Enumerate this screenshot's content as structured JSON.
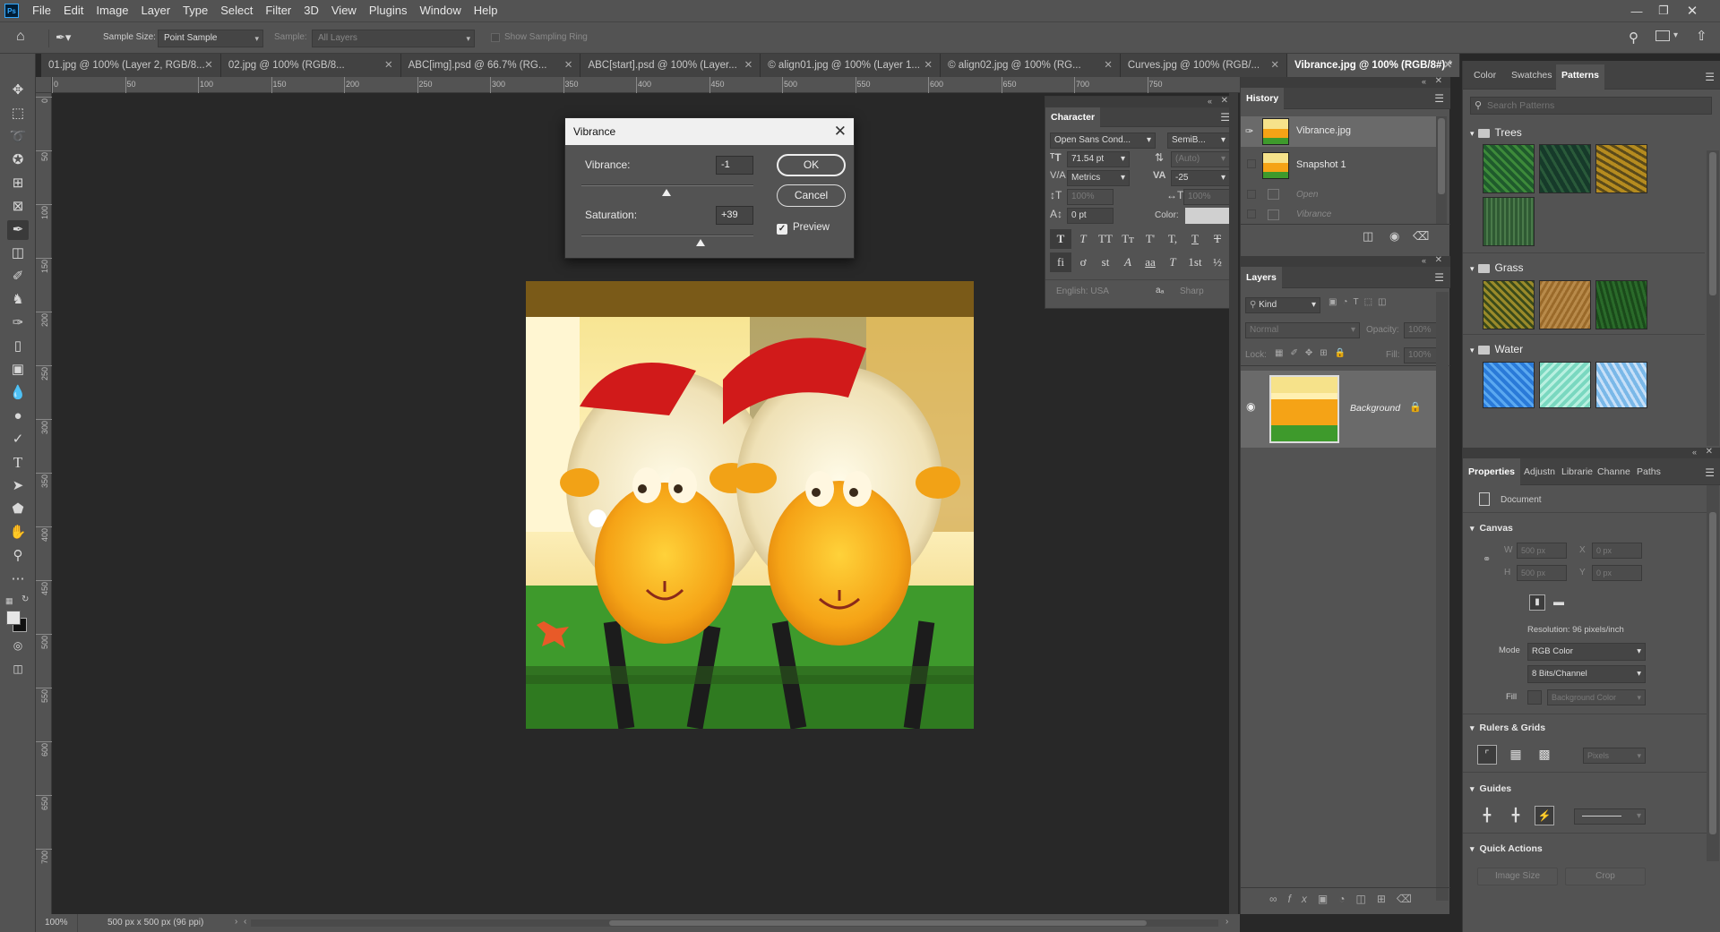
{
  "menubar": {
    "logo": "Ps",
    "items": [
      "File",
      "Edit",
      "Image",
      "Layer",
      "Type",
      "Select",
      "Filter",
      "3D",
      "View",
      "Plugins",
      "Window",
      "Help"
    ]
  },
  "options": {
    "sample_size_label": "Sample Size:",
    "sample_size_value": "Point Sample",
    "sample_label": "Sample:",
    "sample_value": "All Layers",
    "show_ring_label": "Show Sampling Ring"
  },
  "tabs": [
    {
      "label": "01.jpg @ 100% (Layer 2, RGB/8..."
    },
    {
      "label": "02.jpg @ 100% (RGB/8..."
    },
    {
      "label": "ABC[img].psd @ 66.7% (RG..."
    },
    {
      "label": "ABC[start].psd @ 100% (Layer..."
    },
    {
      "label": "© align01.jpg @ 100% (Layer 1..."
    },
    {
      "label": "© align02.jpg @ 100% (RG..."
    },
    {
      "label": "Curves.jpg @ 100% (RGB/..."
    },
    {
      "label": "Vibrance.jpg @ 100% (RGB/8#) *"
    }
  ],
  "ruler_h": [
    "0",
    "50",
    "100",
    "150",
    "200",
    "250",
    "300",
    "350",
    "400",
    "450",
    "500",
    "550",
    "600",
    "650",
    "700",
    "750"
  ],
  "ruler_v": [
    "0",
    "50",
    "100",
    "150",
    "200",
    "250",
    "300",
    "350",
    "400",
    "450",
    "500",
    "550",
    "600",
    "650",
    "700"
  ],
  "status": {
    "zoom": "100%",
    "doc_info": "500 px x 500 px (96 ppi)"
  },
  "vibrance_dialog": {
    "title": "Vibrance",
    "vibrance_label": "Vibrance:",
    "vibrance_value": "-1",
    "vibrance_fraction": 0.495,
    "saturation_label": "Saturation:",
    "saturation_value": "+39",
    "saturation_fraction": 0.695,
    "ok_label": "OK",
    "cancel_label": "Cancel",
    "preview_label": "Preview",
    "preview_checked": true
  },
  "character": {
    "title": "Character",
    "font_family": "Open Sans Cond...",
    "font_style": "SemiB...",
    "size": "71.54 pt",
    "leading": "(Auto)",
    "kerning": "Metrics",
    "tracking": "-25",
    "vscale": "100%",
    "hscale": "100%",
    "baseline": "0 pt",
    "color_label": "Color:",
    "style_buttons": [
      "T",
      "T",
      "TT",
      "Tт",
      "T'",
      "T,",
      "T",
      "T"
    ],
    "ot_buttons": [
      "fi",
      "ơ",
      "st",
      "A",
      "aa",
      "T",
      "1st",
      "½"
    ],
    "language": "English: USA",
    "aa_label": "aa",
    "antialias": "Sharp"
  },
  "history": {
    "title": "History",
    "items": [
      {
        "label": "Vibrance.jpg"
      },
      {
        "label": "Snapshot 1"
      },
      {
        "label": "Open"
      },
      {
        "label": "Vibrance"
      }
    ]
  },
  "layers": {
    "title": "Layers",
    "kind_label": "Kind",
    "blend_mode": "Normal",
    "opacity_label": "Opacity:",
    "opacity_value": "100%",
    "lock_label": "Lock:",
    "fill_label": "Fill:",
    "fill_value": "100%",
    "layer_name": "Background"
  },
  "patterns": {
    "tabs": [
      "Color",
      "Swatches",
      "Patterns"
    ],
    "search_placeholder": "Search Patterns",
    "groups": [
      {
        "name": "Trees",
        "colors": [
          "#1f5a2c",
          "#163a2a",
          "#b58b1f",
          "#2f5a33"
        ]
      },
      {
        "name": "Grass",
        "colors": [
          "#9a8a2a",
          "#9a6a2a",
          "#2a6a2a"
        ]
      },
      {
        "name": "Water",
        "colors": [
          "#2a7ad8",
          "#7ad8c0",
          "#7ab8e8"
        ]
      }
    ]
  },
  "properties": {
    "tabs": [
      "Properties",
      "Adjustn",
      "Librarie",
      "Channe",
      "Paths"
    ],
    "doc_label": "Document",
    "canvas_label": "Canvas",
    "w_label": "W",
    "w_value": "500 px",
    "h_label": "H",
    "h_value": "500 px",
    "x_label": "X",
    "x_value": "0 px",
    "y_label": "Y",
    "y_value": "0 px",
    "resolution": "Resolution: 96 pixels/inch",
    "mode_label": "Mode",
    "mode_value": "RGB Color",
    "bits_value": "8 Bits/Channel",
    "fill_label": "Fill",
    "fill_value": "Background Color",
    "rulers_label": "Rulers & Grids",
    "units_value": "Pixels",
    "guides_label": "Guides",
    "quick_label": "Quick Actions",
    "image_size_label": "Image Size",
    "crop_label": "Crop"
  }
}
